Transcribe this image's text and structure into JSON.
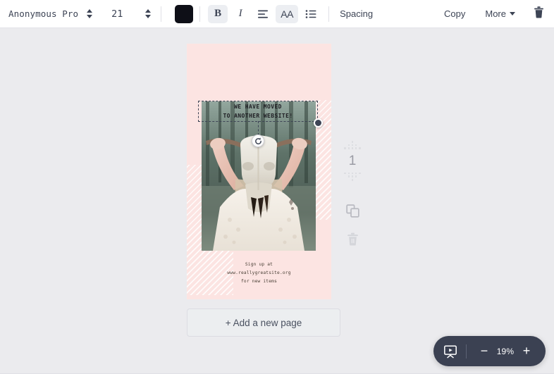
{
  "toolbar": {
    "font_family": "Anonymous Pro",
    "font_size": "21",
    "text_color": "#0e0f17",
    "bold_label": "B",
    "italic_label": "I",
    "case_label": "AA",
    "spacing_label": "Spacing",
    "copy_label": "Copy",
    "more_label": "More",
    "icons": {
      "font_stepper": "stepper-updown-icon",
      "size_stepper": "stepper-updown-icon",
      "align": "align-left-icon",
      "list": "bullet-list-icon",
      "more_caret": "chevron-down-icon",
      "delete": "trash-icon"
    }
  },
  "poster": {
    "background_color": "#fce4e2",
    "selected_text": {
      "line1": "WE HAVE MOVED",
      "line2": "TO ANOTHER WEBSITE!"
    },
    "footer": {
      "line1": "Sign up at",
      "line2": "www.reallygreatsite.org",
      "line3": "for new items"
    },
    "photo_alt": "woman holding animal skull in forest"
  },
  "canvas": {
    "add_page_label": "+ Add a new page"
  },
  "page_tools": {
    "page_number": "1",
    "duplicate_icon": "duplicate-page-icon",
    "delete_icon": "trash-icon",
    "move_up_icon": "arrow-up-dotted-icon",
    "move_down_icon": "arrow-down-dotted-icon"
  },
  "zoom_bar": {
    "present_icon": "present-icon",
    "minus_label": "−",
    "zoom_level": "19%",
    "plus_label": "+",
    "background_color": "#3b4152"
  }
}
